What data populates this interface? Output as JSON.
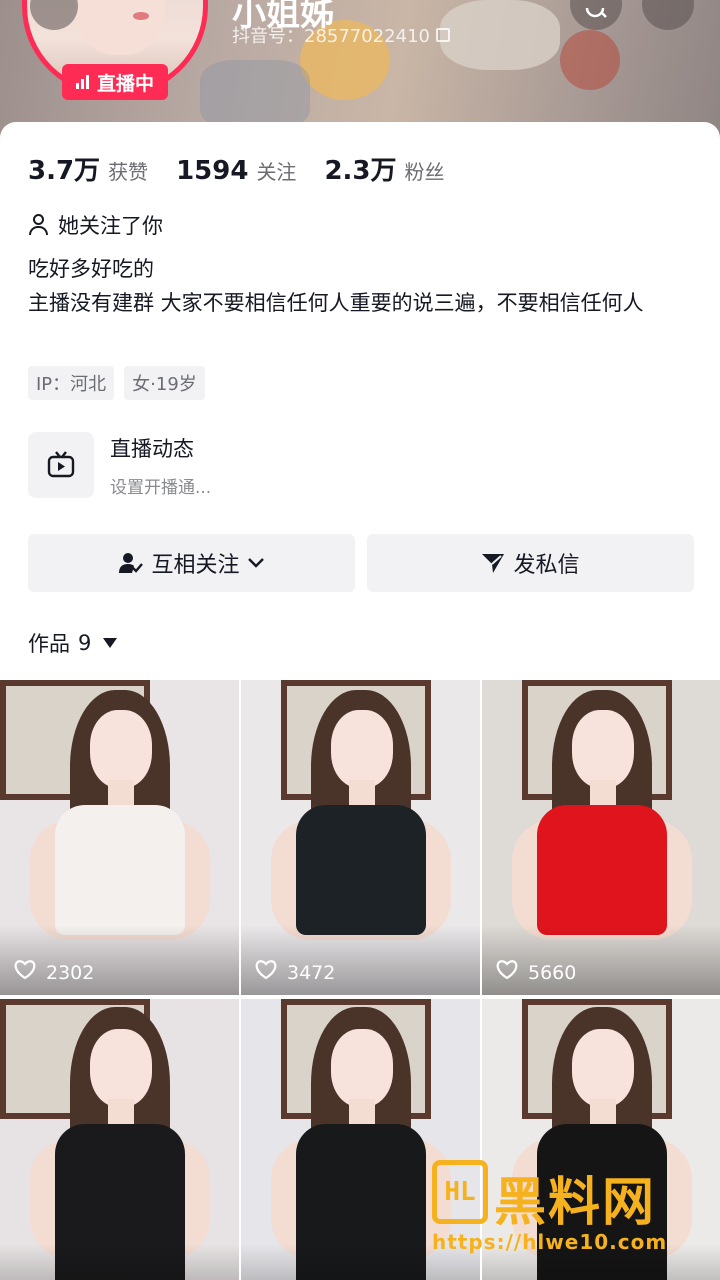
{
  "header": {
    "nickname": "小姐姊",
    "douyin_id": "抖音号：28577022410",
    "live_badge": "直播中"
  },
  "stats": [
    {
      "num": "3.7万",
      "label": "获赞"
    },
    {
      "num": "1594",
      "label": "关注"
    },
    {
      "num": "2.3万",
      "label": "粉丝"
    }
  ],
  "follow_you": "她关注了你",
  "bio": {
    "line1": "吃好多好吃的",
    "line2": "主播没有建群  大家不要相信任何人重要的说三遍，不要相信任何人"
  },
  "tags": [
    "IP：河北",
    "女·19岁"
  ],
  "live_dynamic": {
    "title": "直播动态",
    "subtitle": "设置开播通..."
  },
  "buttons": {
    "follow": "互相关注",
    "message": "发私信"
  },
  "works": {
    "label": "作品",
    "count": "9"
  },
  "videos": [
    {
      "likes": "2302",
      "top_color": "#f4f0ee",
      "wall": "#e9e4e6"
    },
    {
      "likes": "3472",
      "top_color": "#1d2226",
      "wall": "#ebe8ea"
    },
    {
      "likes": "5660",
      "top_color": "#e0141c",
      "wall": "#dedad6"
    },
    {
      "likes": "",
      "top_color": "#1a1a1c",
      "wall": "#e7e3e4"
    },
    {
      "likes": "",
      "top_color": "#18191b",
      "wall": "#e6e6ea"
    },
    {
      "likes": "",
      "top_color": "#151515",
      "wall": "#eceae8"
    }
  ],
  "watermark": {
    "name": "黑料网",
    "url": "https://hlwe10.com",
    "color": "#f5b21e"
  },
  "colors": {
    "accent": "#fe2c55",
    "text": "#161823",
    "secondary": "#6b6d73",
    "button_bg": "#f2f2f4"
  }
}
